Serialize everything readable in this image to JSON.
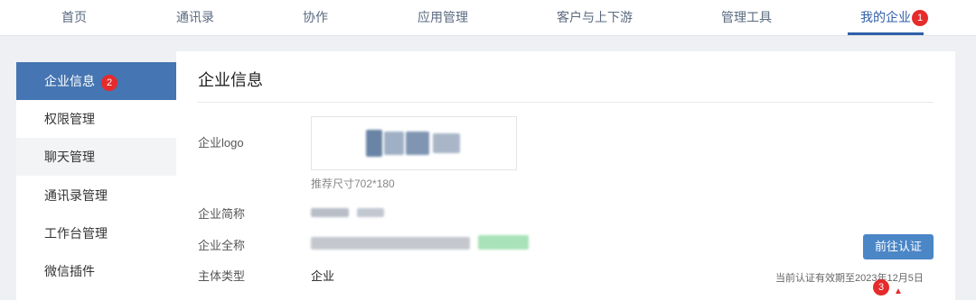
{
  "nav": {
    "items": [
      {
        "label": "首页"
      },
      {
        "label": "通讯录"
      },
      {
        "label": "协作"
      },
      {
        "label": "应用管理"
      },
      {
        "label": "客户与上下游"
      },
      {
        "label": "管理工具"
      },
      {
        "label": "我的企业"
      }
    ],
    "active_index": 6,
    "badge": "1"
  },
  "sidebar": {
    "items": [
      {
        "label": "企业信息"
      },
      {
        "label": "权限管理"
      },
      {
        "label": "聊天管理"
      },
      {
        "label": "通讯录管理"
      },
      {
        "label": "工作台管理"
      },
      {
        "label": "微信插件"
      }
    ],
    "active_index": 0,
    "badge": "2"
  },
  "main": {
    "title": "企业信息",
    "logo_label": "企业logo",
    "logo_hint": "推荐尺寸702*180",
    "short_name_label": "企业简称",
    "full_name_label": "企业全称",
    "entity_type_label": "主体类型",
    "entity_type_value": "企业",
    "verify_button": "前往认证",
    "expiry_text": "当前认证有效期至2023年12月5日",
    "expiry_badge": "3"
  },
  "colors": {
    "accent": "#2f5fa8",
    "sidebar_active": "#4575b2",
    "button": "#4b86c7",
    "badge": "#e52b2b"
  }
}
